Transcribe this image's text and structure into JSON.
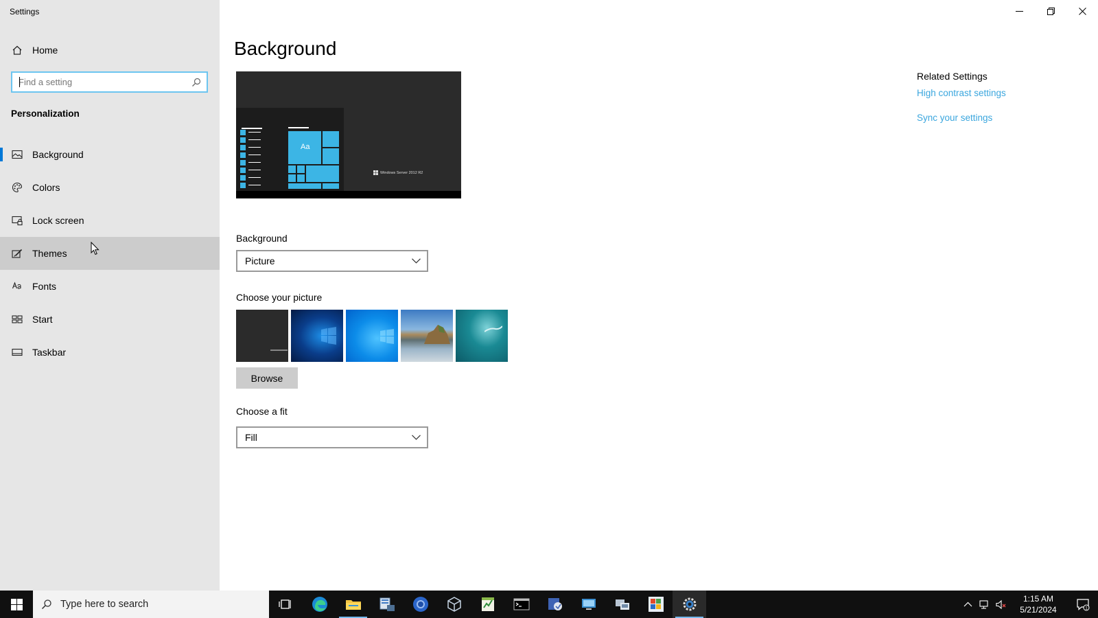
{
  "window": {
    "title": "Settings",
    "minimize_icon": "minimize-icon",
    "restore_icon": "restore-icon",
    "close_icon": "close-icon"
  },
  "sidebar": {
    "home_label": "Home",
    "search_placeholder": "Find a setting",
    "search_value": "",
    "section_heading": "Personalization",
    "items": [
      {
        "label": "Background",
        "icon": "picture-icon",
        "selected": true
      },
      {
        "label": "Colors",
        "icon": "palette-icon"
      },
      {
        "label": "Lock screen",
        "icon": "lock-screen-icon"
      },
      {
        "label": "Themes",
        "icon": "themes-brush-icon",
        "hovered": true
      },
      {
        "label": "Fonts",
        "icon": "fonts-icon"
      },
      {
        "label": "Start",
        "icon": "start-tiles-icon"
      },
      {
        "label": "Taskbar",
        "icon": "taskbar-icon"
      }
    ]
  },
  "main": {
    "page_title": "Background",
    "preview": {
      "tile_label": "Aa",
      "brand_label": "Windows Server 2012 R2"
    },
    "background_field": {
      "label": "Background",
      "value": "Picture"
    },
    "picture_section": {
      "label": "Choose your picture",
      "thumbnails": [
        "dark-default",
        "windows-blue-light",
        "windows-bright-blue",
        "beach-rocks",
        "underwater-swimmer"
      ]
    },
    "browse_label": "Browse",
    "fit_field": {
      "label": "Choose a fit",
      "value": "Fill"
    }
  },
  "related": {
    "title": "Related Settings",
    "links": [
      "High contrast settings",
      "Sync your settings"
    ]
  },
  "taskbar": {
    "search_placeholder": "Type here to search",
    "apps": [
      "task-view-icon",
      "edge-icon",
      "file-explorer-icon",
      "server-manager-icon",
      "chrome-icon",
      "virtualbox-icon",
      "spreadsheet-icon",
      "command-prompt-icon",
      "admin-tools-icon",
      "remote-desktop-icon",
      "network-icon",
      "windows-vista-icon",
      "settings-gear-icon"
    ],
    "clock": {
      "time": "1:15 AM",
      "date": "5/21/2024"
    },
    "notification_count": "1",
    "accent": "#76b9ed"
  },
  "colors": {
    "sidebar_bg": "#e6e6e6",
    "link": "#3aa6de",
    "focus_border": "#6cc5f0",
    "selection_accent": "#0078d7"
  }
}
